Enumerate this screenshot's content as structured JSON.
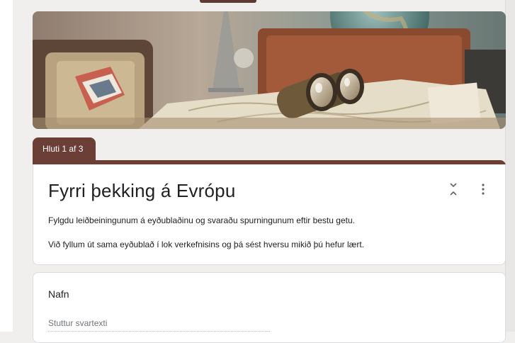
{
  "section": {
    "label": "Hluti 1 af 3"
  },
  "form": {
    "title": "Fyrri þekking á Evrópu",
    "description_1": "Fylgdu leiðbeiningunum á eyðublaðinu og svaraðu spurningunum eftir bestu getu.",
    "description_2": "Við fyllum út sama eyðublað í lok verkefnisins og þá sést hversu mikið þú hefur lært."
  },
  "question": {
    "title": "Nafn",
    "placeholder": "Stuttur svartexti"
  },
  "icons": {
    "collapse": "collapse-icon",
    "more": "more-vert-icon"
  },
  "colors": {
    "theme": "#6b3f36",
    "background": "#f1eeee"
  }
}
